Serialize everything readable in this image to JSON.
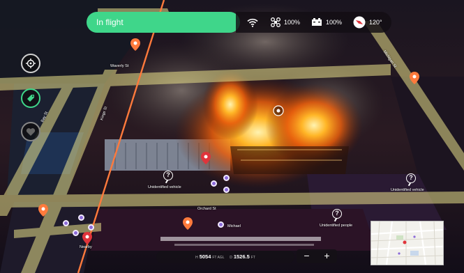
{
  "status": {
    "flight_state": "In flight",
    "signal_icon": "wifi-icon",
    "drone_icon": "drone-icon",
    "drone_battery": "100%",
    "controller_icon": "battery-icon",
    "controller_battery": "100%",
    "compass_icon": "compass-icon",
    "heading": "120°"
  },
  "sidebar": [
    {
      "icon": "crosshair-icon"
    },
    {
      "icon": "tag-icon",
      "color": "#3fd68a"
    },
    {
      "icon": "heart-icon"
    }
  ],
  "streets": {
    "waverly": "Waverly St",
    "orchard": "Orchard St",
    "vertical_a": "Bay St",
    "vertical_b": "Kings St",
    "michigan": "Michigan St"
  },
  "markers": {
    "unknown_vehicle_1": "Unidentified vehicle",
    "unknown_vehicle_2": "Unidentified vehicle",
    "unknown_people": "Unidentified people",
    "michael": "Michael",
    "nearby": "Nearby"
  },
  "telemetry": {
    "altitude_prefix": "H",
    "altitude": "5054",
    "altitude_unit": "FT AGL",
    "distance_prefix": "D",
    "distance": "1526.5",
    "distance_unit": "FT"
  },
  "zoom": {
    "minus": "−",
    "plus": "+"
  },
  "colors": {
    "accent": "#3fd68a",
    "road": "#e9e08a",
    "pin": "#ff7a3c",
    "alert": "#e0343b",
    "person": "#8b6ad9"
  }
}
